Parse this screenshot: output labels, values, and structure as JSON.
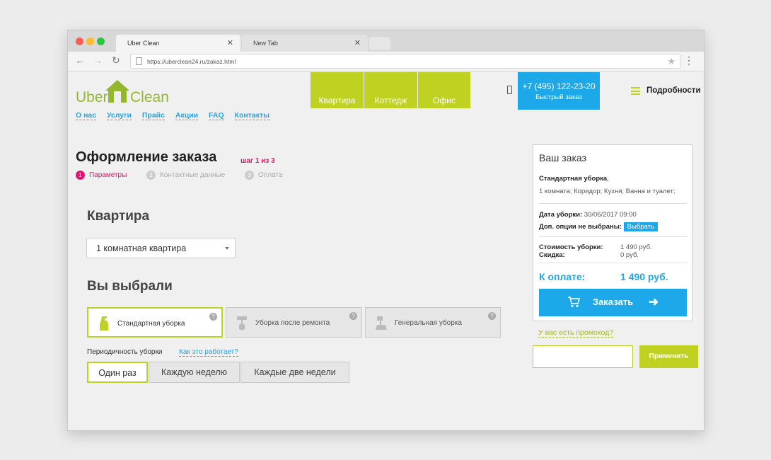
{
  "browser": {
    "tabs": [
      {
        "title": "Uber Clean",
        "close": "✕"
      },
      {
        "title": "New Tab",
        "close": "✕"
      }
    ],
    "url": "https://uberclean24.ru/zakaz.html"
  },
  "header": {
    "logo": {
      "left": "Uber",
      "right": "Clean"
    },
    "menu": [
      "Квартира",
      "Коттедж",
      "Офис"
    ],
    "phone": "+7 (495) 122-23-20",
    "quick_order": "Быстрый заказ",
    "details": "Подробности"
  },
  "subnav": [
    "О нас",
    "Услуги",
    "Прайс",
    "Акции",
    "FAQ",
    "Контакты"
  ],
  "order": {
    "title": "Оформление заказа",
    "step_label": "шаг 1 из 3",
    "steps": [
      {
        "num": "1",
        "label": "Параметры"
      },
      {
        "num": "2",
        "label": "Контактные данные"
      },
      {
        "num": "3",
        "label": "Оплата"
      }
    ],
    "section_apartment": "Квартира",
    "apartment_select": "1 комнатная квартира",
    "section_chosen": "Вы выбрали",
    "services": [
      {
        "label": "Стандартная уборка",
        "help": "?"
      },
      {
        "label": "Уборка после ремонта",
        "help": "?"
      },
      {
        "label": "Генеральная уборка",
        "help": "?"
      }
    ],
    "periodicity_label": "Периодичность уборки",
    "periodicity_help": "Как это работает?",
    "periodicity": [
      "Один раз",
      "Каждую неделю",
      "Каждые две недели"
    ]
  },
  "summary": {
    "title": "Ваш заказ",
    "service": "Стандартная уборка",
    "service_suffix": ",",
    "rooms": "1 комната; Коридор; Кухня; Ванна и туалет;",
    "date_label": "Дата уборки:",
    "date_value": "30/06/2017 09:00",
    "options_label": "Доп. опции не выбраны:",
    "options_button": "Выбрать",
    "cost_label": "Стоимость уборки:",
    "cost_value": "1 490 руб.",
    "discount_label": "Скидка:",
    "discount_value": "0 руб.",
    "total_label": "К оплате:",
    "total_value": "1 490 руб.",
    "order_button": "Заказать",
    "arrow": "➜"
  },
  "promo": {
    "link": "У вас есть промокод?",
    "input_value": "",
    "apply": "Применить"
  },
  "colors": {
    "accent_green": "#bfd121",
    "accent_blue": "#1da8ea",
    "accent_pink": "#e0166e"
  }
}
